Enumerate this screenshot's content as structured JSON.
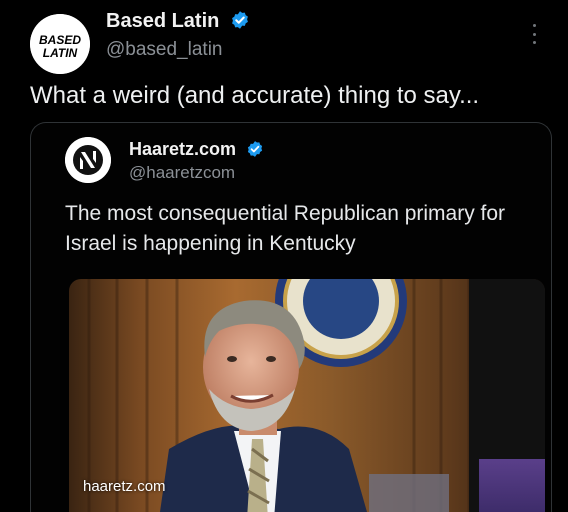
{
  "post": {
    "author": {
      "name": "Based Latin",
      "handle": "@based_latin",
      "avatar_text_top": "BASED",
      "avatar_text_bottom": "LATIN",
      "verified": true
    },
    "text": "What a weird (and accurate) thing to say...",
    "more_icon": "more-vertical-icon"
  },
  "quote": {
    "author": {
      "name": "Haaretz.com",
      "handle": "@haaretzcom",
      "verified": true
    },
    "text": "The most consequential Republican primary for Israel is happening in Kentucky",
    "image": {
      "domain": "haaretz.com"
    }
  },
  "colors": {
    "background": "#000000",
    "verified_badge": "#1d9bf0",
    "muted_text": "#8b9096",
    "card_border": "#2f3336"
  }
}
